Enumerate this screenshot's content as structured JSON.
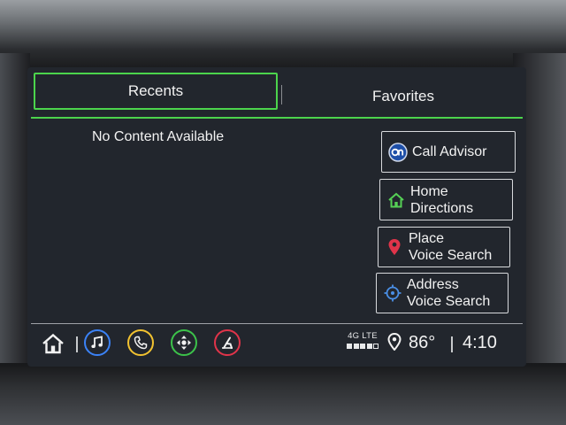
{
  "tabs": [
    {
      "label": "Recents",
      "active": true
    },
    {
      "label": "Favorites",
      "active": false
    }
  ],
  "content": {
    "empty_message": "No Content Available"
  },
  "actions": [
    {
      "icon": "onstar-icon",
      "lines": [
        "Call Advisor"
      ]
    },
    {
      "icon": "home-icon",
      "lines": [
        "Home",
        "Directions"
      ]
    },
    {
      "icon": "location-pin-icon",
      "lines": [
        "Place",
        "Voice Search"
      ]
    },
    {
      "icon": "crosshair-icon",
      "lines": [
        "Address",
        "Voice Search"
      ]
    }
  ],
  "bottom_bar": {
    "apps": [
      {
        "icon": "home-icon"
      },
      {
        "icon": "music-note-icon",
        "color": "#3b82f6"
      },
      {
        "icon": "phone-icon",
        "color": "#f2c230"
      },
      {
        "icon": "navigation-dpad-icon",
        "color": "#3cc24a"
      },
      {
        "icon": "seat-icon",
        "color": "#e0344a"
      }
    ],
    "network": "4G LTE",
    "signal_level": 4,
    "signal_max": 5,
    "temperature": "86°",
    "time": "4:10"
  },
  "colors": {
    "accent": "#4cd44c"
  }
}
